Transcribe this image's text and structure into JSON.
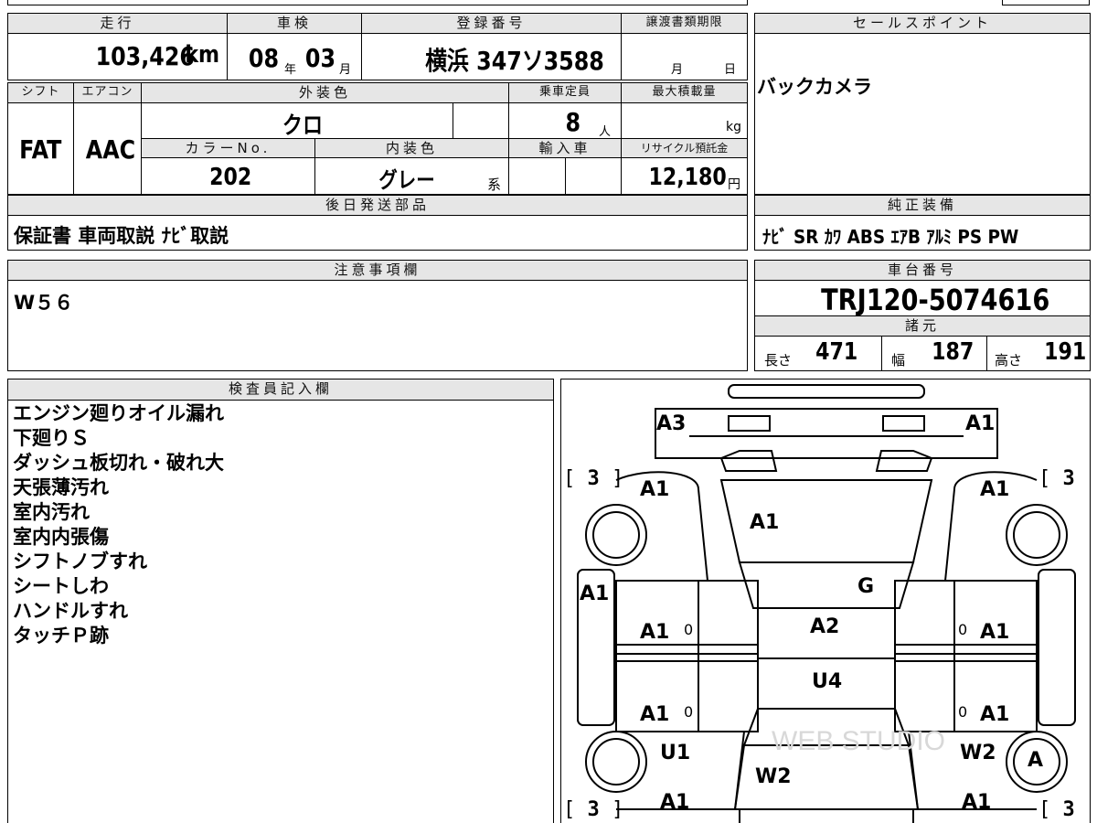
{
  "top": {
    "mileage_header": "走行",
    "mileage_value": "103,426",
    "mileage_unit": "km",
    "shaken_header": "車検",
    "shaken_year": "08",
    "shaken_year_unit": "年",
    "shaken_month": "03",
    "shaken_month_unit": "月",
    "reg_header": "登録番号",
    "reg_value": "横浜 347ソ3588",
    "transfer_header": "譲渡書類期限",
    "transfer_month_unit": "月",
    "transfer_day_unit": "日",
    "sales_header": "セールスポイント",
    "sales_value": "バックカメラ"
  },
  "row2": {
    "shift_header": "シフト",
    "shift_value": "FAT",
    "ac_header": "エアコン",
    "ac_value": "AAC",
    "exterior_header": "外装色",
    "exterior_value": "クロ",
    "capacity_header": "乗車定員",
    "capacity_value": "8",
    "capacity_unit": "人",
    "load_header": "最大積載量",
    "load_unit": "kg",
    "color_no_header": "カラーNo.",
    "color_no_value": "202",
    "interior_header": "内装色",
    "interior_value": "グレー",
    "interior_suffix": "系",
    "import_header": "輸入車",
    "recycle_header": "リサイクル預託金",
    "recycle_value": "12,180",
    "recycle_unit": "円"
  },
  "later": {
    "header": "後日発送部品",
    "value": "保証書 車両取説 ﾅﾋﾞ取説"
  },
  "equipment": {
    "header": "純正装備",
    "value": "ﾅﾋﾞ SR ｶﾜ ABS ｴｱB ｱﾙﾐ PS PW"
  },
  "notes": {
    "header": "注意事項欄",
    "value": "W５６"
  },
  "chassis": {
    "header": "車台番号",
    "value": "TRJ120-5074616",
    "spec_header": "諸元",
    "length_label": "長さ",
    "length_value": "471",
    "width_label": "幅",
    "width_value": "187",
    "height_label": "高さ",
    "height_value": "191"
  },
  "inspector": {
    "header": "検査員記入欄",
    "items": [
      "エンジン廻りオイル漏れ",
      "下廻りＳ",
      "ダッシュ板切れ・破れ大",
      "天張薄汚れ",
      "室内汚れ",
      "室内内張傷",
      "シフトノブすれ",
      "シートしわ",
      "ハンドルすれ",
      "タッチＰ跡"
    ]
  },
  "diagram": {
    "marks": {
      "front_left": "A3",
      "front_right": "A1",
      "fender_fl": "A1",
      "fender_fr": "A1",
      "hood": "A1",
      "windshield": "G",
      "pillar_left": "A1",
      "door_fl": "A1",
      "door_fr": "A1",
      "roof": "A2",
      "roof_rear": "U4",
      "door_rl": "A1",
      "door_rr": "A1",
      "quarter_rl": "U1",
      "quarter_rr": "W2",
      "rear_glass": "W2",
      "rear_wheel_r": "A",
      "rear_left": "A1",
      "rear_right": "A1"
    },
    "zero_mark": "0",
    "bracket_value": "3",
    "watermark": "WEB STUDIO"
  }
}
